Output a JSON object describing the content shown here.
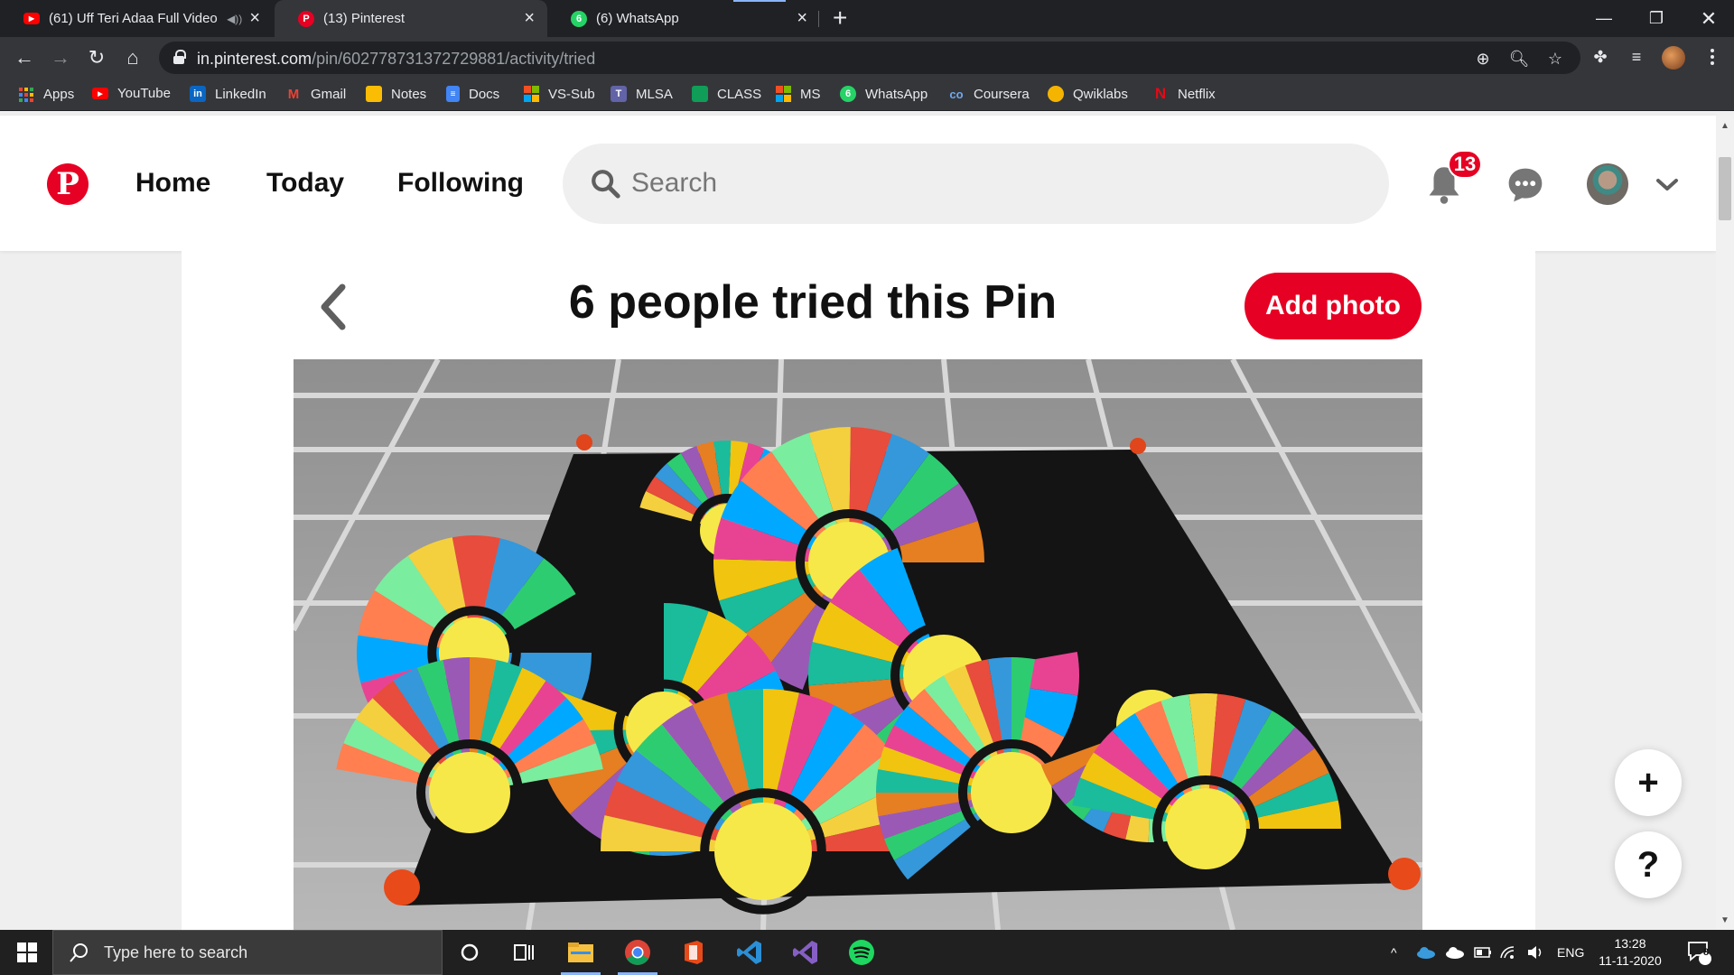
{
  "browser": {
    "tabs": [
      {
        "title": "(61) Uff Teri Adaa Full Video",
        "favicon": "youtube-icon",
        "color": "#ff0000",
        "active": false
      },
      {
        "title": "(13) Pinterest",
        "favicon": "pinterest-icon",
        "color": "#e60023",
        "active": true
      },
      {
        "title": "(6) WhatsApp",
        "favicon": "whatsapp-icon",
        "color": "#25d366",
        "badge": "6",
        "active": false
      }
    ],
    "url_host": "in.pinterest.com",
    "url_path": "/pin/602778731372729881/activity/tried"
  },
  "bookmarks": [
    {
      "label": "Apps",
      "icon": "apps-grid-icon",
      "color": "#4285f4"
    },
    {
      "label": "YouTube",
      "icon": "youtube-icon",
      "color": "#ff0000"
    },
    {
      "label": "LinkedIn",
      "icon": "linkedin-icon",
      "color": "#0a66c2",
      "glyph": "in"
    },
    {
      "label": "Gmail",
      "icon": "gmail-icon",
      "color": "#ea4335",
      "glyph": "M"
    },
    {
      "label": "Notes",
      "icon": "notes-icon",
      "color": "#fbbc04"
    },
    {
      "label": "Docs",
      "icon": "docs-icon",
      "color": "#4285f4"
    },
    {
      "label": "VS-Sub",
      "icon": "microsoft-icon",
      "color": "#f25022"
    },
    {
      "label": "MLSA",
      "icon": "teams-icon",
      "color": "#6264a7"
    },
    {
      "label": "CLASS",
      "icon": "classroom-icon",
      "color": "#0f9d58"
    },
    {
      "label": "MS",
      "icon": "microsoft-icon",
      "color": "#f25022"
    },
    {
      "label": "WhatsApp",
      "icon": "whatsapp-icon",
      "color": "#25d366",
      "glyph": "6"
    },
    {
      "label": "Coursera",
      "icon": "coursera-icon",
      "color": "#2a73cc",
      "glyph": "co"
    },
    {
      "label": "Qwiklabs",
      "icon": "qwiklabs-icon",
      "color": "#f4b400"
    },
    {
      "label": "Netflix",
      "icon": "netflix-icon",
      "color": "#e50914",
      "glyph": "N"
    }
  ],
  "pinterest": {
    "nav": [
      "Home",
      "Today",
      "Following"
    ],
    "search_placeholder": "Search",
    "notification_count": "13",
    "page_title": "6 people tried this Pin",
    "add_photo_label": "Add photo",
    "brand_color": "#e60023"
  },
  "fabs": {
    "plus": "+",
    "help": "?"
  },
  "taskbar": {
    "search_placeholder": "Type here to search",
    "language": "ENG",
    "time": "13:28",
    "date": "11-11-2020",
    "notification_count": "8"
  }
}
